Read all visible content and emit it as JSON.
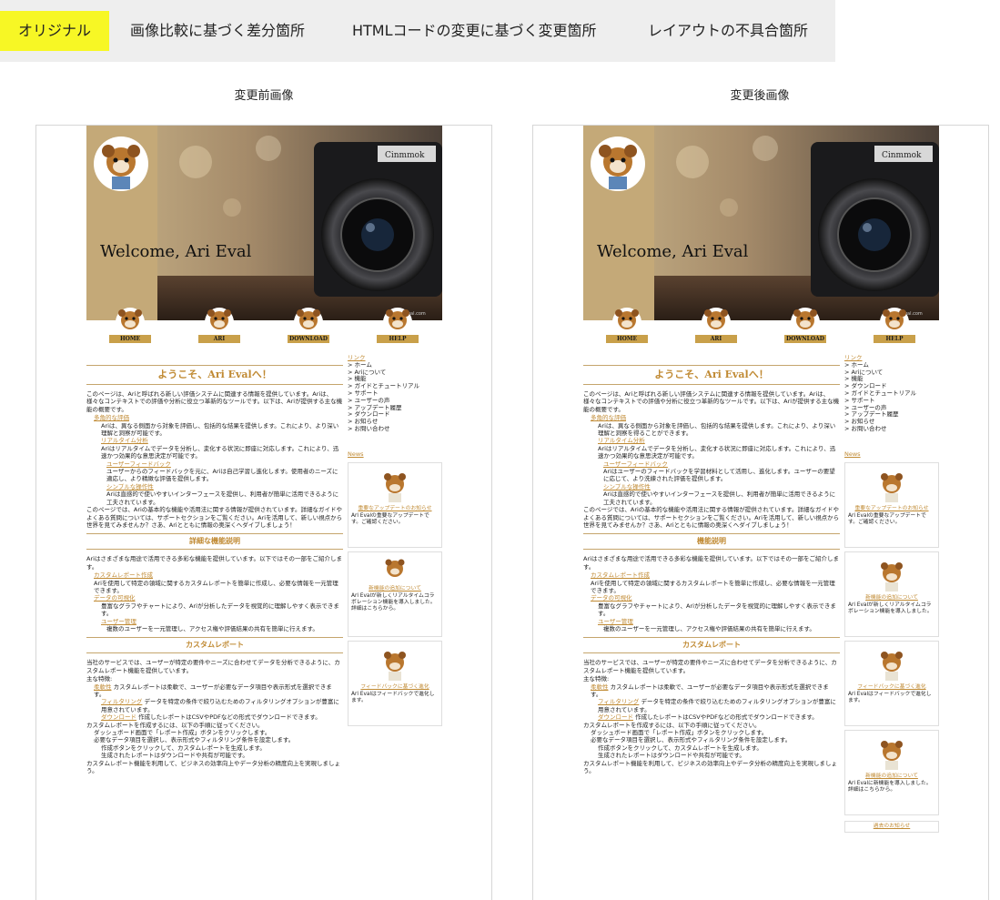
{
  "tabs": [
    {
      "label": "オリジナル",
      "active": true
    },
    {
      "label": "画像比較に基づく差分箇所",
      "active": false
    },
    {
      "label": "HTMLコードの変更に基づく変更箇所",
      "active": false
    },
    {
      "label": "レイアウトの不具合箇所",
      "active": false
    }
  ],
  "panels": {
    "before_title": "変更前画像",
    "after_title": "変更後画像"
  },
  "colors": {
    "accent": "#f7f725",
    "gold": "#c08a33",
    "tab_bg": "#eeeeee"
  },
  "site": {
    "welcome": "Welcome, Ari Eval",
    "camera_brand": "Cinmmok",
    "watermark": "eval.com",
    "nav": [
      "HOME",
      "ARI",
      "DOWNLOAD",
      "HELP"
    ],
    "sidebar": {
      "links_title": "リンク",
      "news_title": "News",
      "past_news": "過去のお知らせ"
    }
  },
  "before": {
    "intro_title": "ようこそ、Ari Evalへ！",
    "intro_text": "このページは、Ariと呼ばれる新しい評価システムに関連する情報を提供しています。Ariは、様々なコンテキストでの評価や分析に役立つ革新的なツールです。以下は、Ariが提供する主な機能の概要です。",
    "features": [
      {
        "name": "多角的な評価",
        "desc": "Ariは、異なる側面から対象を評価し、包括的な結果を提供します。これにより、より深い理解と洞察が可能です。"
      },
      {
        "name": "リアルタイム分析",
        "desc": "Ariはリアルタイムでデータを分析し、変化する状況に即座に対応します。これにより、迅速かつ効果的な意思決定が可能です。"
      },
      {
        "name": "ユーザーフィードバック",
        "desc": "ユーザーからのフィードバックを元に、Ariは自己学習し進化します。使用者のニーズに適応し、より精緻な評価を提供します。"
      },
      {
        "name": "シンプルな操作性",
        "desc": "Ariは直感的で使いやすいインターフェースを提供し、利用者が簡単に活用できるように工夫されています。"
      }
    ],
    "intro_outro": "このページでは、Ariの基本的な機能や活用法に関する情報が提供されています。詳細なガイドやよくある質問については、サポートセクションをご覧ください。Ariを活用して、新しい視点から世界を見てみませんか？さあ、Ariとともに情報の奥深くへダイブしましょう！",
    "detail_title": "詳細な機能説明",
    "detail_text": "Ariはさまざまな用途で活用できる多彩な機能を提供しています。以下ではその一部をご紹介します。",
    "detail_items": [
      {
        "name": "カスタムレポート作成",
        "desc": "Ariを使用して特定の領域に関するカスタムレポートを簡単に作成し、必要な情報を一元管理できます。"
      },
      {
        "name": "データの可視化",
        "desc": "豊富なグラフやチャートにより、Ariが分析したデータを視覚的に理解しやすく表示できます。"
      },
      {
        "name": "ユーザー管理",
        "desc": "複数のユーザーを一元管理し、アクセス権や評価結果の共有を簡単に行えます。"
      }
    ],
    "report_title": "カスタムレポート",
    "report_text": "当社のサービスでは、ユーザーが特定の要件やニーズに合わせてデータを分析できるように、カスタムレポート機能を提供しています。",
    "report_features_label": "主な特徴:",
    "report_features": [
      {
        "name": "柔軟性",
        "desc": "カスタムレポートは柔軟で、ユーザーが必要なデータ項目や表示形式を選択できます。"
      },
      {
        "name": "フィルタリング",
        "desc": "データを特定の条件で絞り込むためのフィルタリングオプションが豊富に用意されています。"
      },
      {
        "name": "ダウンロード",
        "desc": "作成したレポートはCSVやPDFなどの形式でダウンロードできます。"
      }
    ],
    "report_steps_label": "カスタムレポートを作成するには、以下の手順に従ってください。",
    "report_steps": [
      "ダッシュボード画面で「レポート作成」ボタンをクリックします。",
      "必要なデータ項目を選択し、表示形式やフィルタリング条件を設定します。",
      "作成ボタンをクリックして、カスタムレポートを生成します。",
      "生成されたレポートはダウンロードや共有が可能です。"
    ],
    "report_outro": "カスタムレポート機能を利用して、ビジネスの効率向上やデータ分析の精度向上を実現しましょう。",
    "links": [
      "ホーム",
      "Ariについて",
      "機能",
      "ガイドとチュートリアル",
      "サポート",
      "ユーザーの声",
      "アップデート履歴",
      "ダウンロード",
      "お知らせ",
      "お問い合わせ"
    ],
    "news": [
      {
        "title": "重要なアップデートのお知らせ",
        "text": "Ari Evalの重要なアップデートです。ご確認ください。"
      },
      {
        "title": "新機能の追加について",
        "text": "Ari Evalが新しくリアルタイムコラボレーション機能を導入しました。詳細はこちらから。"
      },
      {
        "title": "フィードバックに基づく進化",
        "text": "Ari Evalはフィードバックで進化します。"
      }
    ]
  },
  "after": {
    "intro_title": "ようこそ、Ari Evalへ！",
    "intro_text": "このページは、Ariと呼ばれる新しい評価システムに関連する情報を提供しています。Ariは、様々なコンテキストでの評価や分析に役立つ革新的なツールです。以下は、Ariが提供する主な機能の概要です。",
    "features": [
      {
        "name": "多角的な評価",
        "desc": "Ariは、異なる側面から対象を評価し、包括的な結果を提供します。これにより、より深い理解と洞察を得ることができます。"
      },
      {
        "name": "リアルタイム分析",
        "desc": "Ariはリアルタイムでデータを分析し、変化する状況に即座に対応します。これにより、迅速かつ効果的な意思決定が可能です。"
      },
      {
        "name": "ユーザーフィードバック",
        "desc": "Ariはユーザーのフィードバックを学習材料として活用し、進化します。ユーザーの要望に応じて、より洗練された評価を提供します。"
      },
      {
        "name": "シンプルな操作性",
        "desc": "Ariは直感的で使いやすいインターフェースを提供し、利用者が簡単に活用できるように工夫されています。"
      }
    ],
    "intro_outro": "このページでは、Ariの基本的な機能や活用法に関する情報が提供されています。詳細なガイドやよくある質問については、サポートセクションをご覧ください。Ariを活用して、新しい視点から世界を見てみませんか？さあ、Ariとともに情報の奥深くへダイブしましょう！",
    "detail_title": "機能説明",
    "detail_text": "Ariはさまざまな用途で活用できる多彩な機能を提供しています。以下ではその一部をご紹介します。",
    "detail_items": [
      {
        "name": "カスタムレポート作成",
        "desc": "Ariを使用して特定の領域に関するカスタムレポートを簡単に作成し、必要な情報を一元管理できます。"
      },
      {
        "name": "データの可視化",
        "desc": "豊富なグラフやチャートにより、Ariが分析したデータを視覚的に理解しやすく表示できます。"
      },
      {
        "name": "ユーザー管理",
        "desc": "複数のユーザーを一元管理し、アクセス権や評価結果の共有を簡単に行えます。"
      }
    ],
    "report_title": "カスタムレポート",
    "report_text": "当社のサービスでは、ユーザーが特定の要件やニーズに合わせてデータを分析できるように、カスタムレポート機能を提供しています。",
    "report_features_label": "主な特徴:",
    "report_features": [
      {
        "name": "柔軟性",
        "desc": "カスタムレポートは柔軟で、ユーザーが必要なデータ項目や表示形式を選択できます。"
      },
      {
        "name": "フィルタリング",
        "desc": "データを特定の条件で絞り込むためのフィルタリングオプションが豊富に用意されています。"
      },
      {
        "name": "ダウンロード",
        "desc": "作成したレポートはCSVやPDFなどの形式でダウンロードできます。"
      }
    ],
    "report_steps_label": "カスタムレポートを作成するには、以下の手順に従ってください。",
    "report_steps": [
      "ダッシュボード画面で「レポート作成」ボタンをクリックします。",
      "必要なデータ項目を選択し、表示形式やフィルタリング条件を設定します。",
      "作成ボタンをクリックして、カスタムレポートを生成します。",
      "生成されたレポートはダウンロードや共有が可能です。"
    ],
    "report_outro": "カスタムレポート機能を利用して、ビジネスの効率向上やデータ分析の精度向上を実現しましょう。",
    "links": [
      "ホーム",
      "Ariについて",
      "機能",
      "ダウンロード",
      "ガイドとチュートリアル",
      "サポート",
      "ユーザーの声",
      "アップデート履歴",
      "お知らせ",
      "お問い合わせ"
    ],
    "news": [
      {
        "title": "重要なアップデートのお知らせ",
        "text": "Ari Evalの重要なアップデートです。ご確認ください。"
      },
      {
        "title": "新機能の追加について",
        "text": "Ari Evalが新しくリアルタイムコラボレーション機能を導入しました。"
      },
      {
        "title": "フィードバックに基づく進化",
        "text": "Ari Evalはフィードバックで進化します。"
      },
      {
        "title": "新機能の追加について",
        "text": "Ari Evalに新機能を導入しました。詳細はこちらから。"
      }
    ]
  }
}
